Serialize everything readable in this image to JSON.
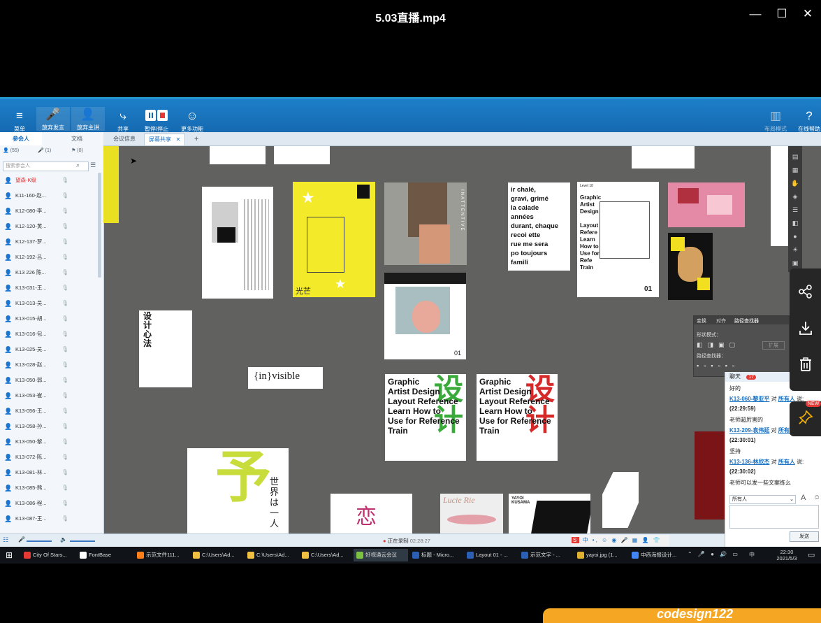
{
  "player": {
    "title": "5.03直播.mp4",
    "minimize": "✕",
    "maximize": "☐",
    "close": "✕"
  },
  "app_toolbar": {
    "buttons": [
      {
        "label": "菜单",
        "icon": "≡"
      },
      {
        "label": "放弃发言",
        "icon": "🎤"
      },
      {
        "label": "放弃主讲",
        "icon": "👤"
      },
      {
        "label": "共享",
        "icon": "⤷"
      },
      {
        "label": "暂停/停止",
        "icon": "⏸"
      },
      {
        "label": "更多功能",
        "icon": "☺"
      }
    ],
    "right_buttons": [
      {
        "label": "布局模式",
        "icon": "▥"
      },
      {
        "label": "在线帮助",
        "icon": "?"
      }
    ]
  },
  "content_tabs": [
    {
      "label": "会议信息"
    },
    {
      "label": "屏幕共享",
      "close": "✕"
    },
    {
      "label": "+"
    }
  ],
  "left_panel": {
    "tabs": [
      "参会人",
      "文档"
    ],
    "subtabs": [
      "(55)",
      "(1)",
      "(0)"
    ],
    "search_placeholder": "搜索参会人",
    "members": [
      "望森-K级",
      "K11-160-赵...",
      "K12-080-李...",
      "K12-120-黄...",
      "K12-137-罗...",
      "K12-192-吕...",
      "K13 226 陈...",
      "K13-031-王...",
      "K13-013-吴...",
      "K13-015-胡...",
      "K13-016-包...",
      "K13-025-吴...",
      "K13-028-赵...",
      "K13-050-郭...",
      "K13-053-崔...",
      "K13-056-王...",
      "K13-058-孙...",
      "K13-050-黎...",
      "K13-072-陈...",
      "K13-081-林...",
      "K13-085-熊...",
      "K13-086-程...",
      "K13-087-王..."
    ]
  },
  "bottom_bar": {
    "recording_text": "正在录制",
    "recording_time": "02:28:27"
  },
  "ps_panel": {
    "tabs": [
      "变换",
      "对齐",
      "路径查找器"
    ],
    "shape_modes": "形状模式：",
    "pathfinder": "路径查找器：",
    "expand": "扩展"
  },
  "artworks": {
    "design_method": "设计心法",
    "invisible": "{in}visible",
    "graphic_text": [
      "Graphic",
      "Artist Design",
      "Layout Reference",
      "Learn How to",
      "Use for Reference",
      "Train"
    ],
    "sheji": "设计",
    "guangmang": "光芒",
    "level": "Level 10",
    "page_01": "01",
    "inattentive": "INATTENTIVE",
    "calade": [
      "ir chalé,",
      "gravi, grimé",
      "la calade",
      "années",
      "durant, chaque",
      "recoi  ette",
      "rue  me sera",
      "po  toujours",
      "famili"
    ],
    "sekai": "世界は一人",
    "yu": "予",
    "yayoi": "YAYOI KUSAMA",
    "lucie": "Lucie Rie"
  },
  "chat": {
    "title": "聊天",
    "badge": "17",
    "messages": [
      {
        "type": "text",
        "text": "好的"
      },
      {
        "type": "from",
        "name": "K13-060-黎亚平",
        "to": "对",
        "target": "所有人",
        "suffix": "说:"
      },
      {
        "type": "time",
        "text": "(22:29:59)"
      },
      {
        "type": "text",
        "text": "老师超厉害的"
      },
      {
        "type": "from",
        "name": "K13-209-袁伟延",
        "to": "对",
        "target": "所有人",
        "suffix": "说:"
      },
      {
        "type": "time",
        "text": "(22:30:01)"
      },
      {
        "type": "text",
        "text": "坚持"
      },
      {
        "type": "from",
        "name": "K13-136-林欣杰",
        "to": "对",
        "target": "所有人",
        "suffix": "说:"
      },
      {
        "type": "time",
        "text": "(22:30:02)"
      },
      {
        "type": "text",
        "text": "老师可以发一些文案练么"
      }
    ],
    "recipient": "所有人",
    "send_label": "发送"
  },
  "side_tools": {
    "new_badge": "NEW"
  },
  "taskbar": {
    "items": [
      {
        "label": "City Of Stars...",
        "color": "#e53935"
      },
      {
        "label": "FontBase",
        "color": "#ffffff"
      },
      {
        "label": "示范文件111...",
        "color": "#ff7f18"
      },
      {
        "label": "C:\\Users\\Ad...",
        "color": "#f0c040"
      },
      {
        "label": "C:\\Users\\Ad...",
        "color": "#f0c040"
      },
      {
        "label": "C:\\Users\\Ad...",
        "color": "#f0c040"
      },
      {
        "label": "好视通云会议",
        "color": "#7cc242"
      },
      {
        "label": "标题 - Micro...",
        "color": "#2b5fb4"
      },
      {
        "label": "Layout 01 - ...",
        "color": "#2b5fb4"
      },
      {
        "label": "示范文字 - ...",
        "color": "#2b5fb4"
      },
      {
        "label": "yayoi.jpg (1...",
        "color": "#e0b030"
      },
      {
        "label": "中西海报设计...",
        "color": "#4285f4"
      }
    ],
    "clock_time": "22:30",
    "clock_date": "2021/5/3",
    "ime": "中"
  },
  "watermark": {
    "text": "codesign122"
  }
}
